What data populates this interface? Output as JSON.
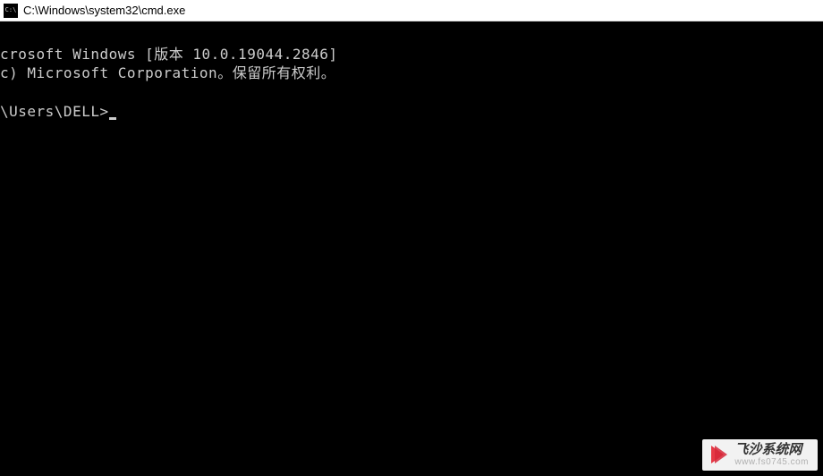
{
  "window": {
    "title": "C:\\Windows\\system32\\cmd.exe"
  },
  "terminal": {
    "line1": "crosoft Windows [版本 10.0.19044.2846]",
    "line2": "c) Microsoft Corporation。保留所有权利。",
    "blank": "",
    "prompt": "\\Users\\DELL>"
  },
  "watermark": {
    "title": "飞沙系统网",
    "url": "www.fs0745.com"
  }
}
